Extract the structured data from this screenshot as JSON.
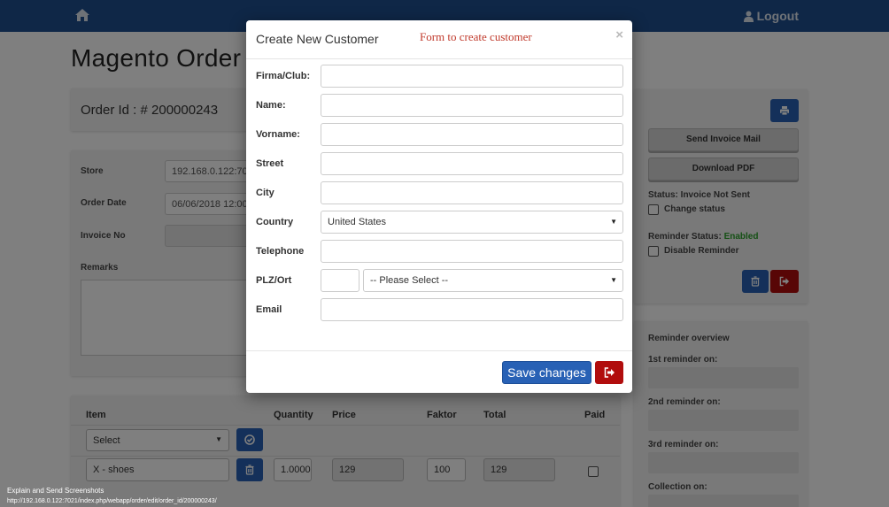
{
  "navbar": {
    "home_icon": "home-icon",
    "logout_icon": "user-icon",
    "logout_label": "Logout"
  },
  "page": {
    "title": "Magento Order"
  },
  "order": {
    "id_label": "Order Id : # 200000243"
  },
  "order_form": {
    "store_label": "Store",
    "store_value": "192.168.0.122:7021",
    "order_date_label": "Order Date",
    "order_date_value": "06/06/2018 12:00 AM",
    "invoice_no_label": "Invoice No",
    "invoice_no_value": "",
    "remarks_label": "Remarks"
  },
  "items": {
    "headers": {
      "item": "Item",
      "quantity": "Quantity",
      "price": "Price",
      "faktor": "Faktor",
      "total": "Total",
      "paid": "Paid"
    },
    "select_value": "Select",
    "row": {
      "item": "X - shoes",
      "quantity": "1.0000",
      "price": "129",
      "faktor": "100",
      "total": "129",
      "paid": false
    }
  },
  "side": {
    "send_invoice_mail": "Send Invoice Mail",
    "download_pdf": "Download PDF",
    "status_text": "Status: Invoice Not Sent",
    "change_status": "Change status",
    "reminder_status_label": "Reminder Status:",
    "reminder_status_value": "Enabled",
    "disable_reminder": "Disable Reminder"
  },
  "reminders": {
    "title": "Reminder overview",
    "first": "1st reminder on:",
    "second": "2nd reminder on:",
    "third": "3rd reminder on:",
    "collection": "Collection on:"
  },
  "modal": {
    "title": "Create New Customer",
    "annotation": "Form to create customer",
    "close": "×",
    "fields": {
      "firma_label": "Firma/Club:",
      "name_label": "Name:",
      "vorname_label": "Vorname:",
      "street_label": "Street",
      "city_label": "City",
      "country_label": "Country",
      "country_value": "United States",
      "telephone_label": "Telephone",
      "plz_label": "PLZ/Ort",
      "ort_value": "-- Please Select --",
      "email_label": "Email"
    },
    "save_label": "Save changes"
  },
  "footer": {
    "explain": "Explain and Send Screenshots",
    "url": "http://192.168.0.122:7021/index.php/webapp/order/edit/order_id/200000243/"
  },
  "colors": {
    "navbar": "#1f4f8f",
    "primary": "#2861b5",
    "danger": "#b10d0d",
    "success": "#2aa12a",
    "annotation": "#c0392b"
  }
}
